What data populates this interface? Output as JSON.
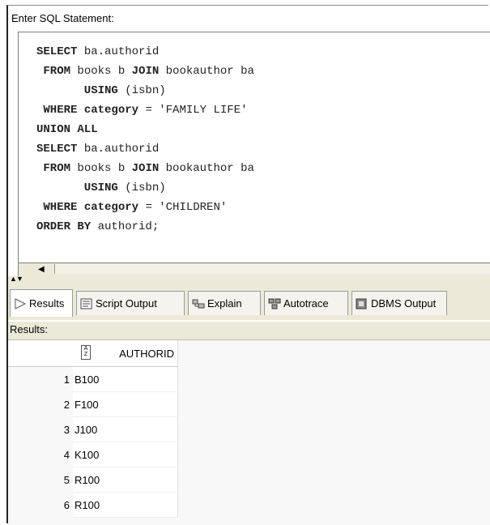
{
  "editor": {
    "label": "Enter SQL Statement:",
    "lines": [
      [
        {
          "t": "SELECT",
          "k": true
        },
        {
          "t": " ba.authorid",
          "k": false
        }
      ],
      [
        {
          "t": " FROM",
          "k": true
        },
        {
          "t": " books b ",
          "k": false
        },
        {
          "t": "JOIN",
          "k": true
        },
        {
          "t": " bookauthor ba",
          "k": false
        }
      ],
      [
        {
          "t": "       USING",
          "k": true
        },
        {
          "t": " (isbn)",
          "k": false
        }
      ],
      [
        {
          "t": " WHERE",
          "k": true
        },
        {
          "t": " ",
          "k": false
        },
        {
          "t": "category",
          "k": true
        },
        {
          "t": " = 'FAMILY LIFE'",
          "k": false
        }
      ],
      [
        {
          "t": "UNION ALL",
          "k": true
        }
      ],
      [
        {
          "t": "SELECT",
          "k": true
        },
        {
          "t": " ba.authorid",
          "k": false
        }
      ],
      [
        {
          "t": " FROM",
          "k": true
        },
        {
          "t": " books b ",
          "k": false
        },
        {
          "t": "JOIN",
          "k": true
        },
        {
          "t": " bookauthor ba",
          "k": false
        }
      ],
      [
        {
          "t": "       USING",
          "k": true
        },
        {
          "t": " (isbn)",
          "k": false
        }
      ],
      [
        {
          "t": " WHERE",
          "k": true
        },
        {
          "t": " ",
          "k": false
        },
        {
          "t": "category",
          "k": true
        },
        {
          "t": " = 'CHILDREN'",
          "k": false
        }
      ],
      [
        {
          "t": "ORDER BY",
          "k": true
        },
        {
          "t": " authorid;",
          "k": false
        }
      ]
    ]
  },
  "tabs": [
    {
      "label": "Results",
      "icon": "play-arrow-icon",
      "active": true
    },
    {
      "label": "Script Output",
      "icon": "script-output-icon",
      "active": false
    },
    {
      "label": "Explain",
      "icon": "explain-plan-icon",
      "active": false
    },
    {
      "label": "Autotrace",
      "icon": "autotrace-icon",
      "active": false
    },
    {
      "label": "DBMS Output",
      "icon": "dbms-output-icon",
      "active": false
    }
  ],
  "results": {
    "label": "Results:",
    "column": "AUTHORID",
    "rows": [
      {
        "n": "1",
        "v": "B100"
      },
      {
        "n": "2",
        "v": "F100"
      },
      {
        "n": "3",
        "v": "J100"
      },
      {
        "n": "4",
        "v": "K100"
      },
      {
        "n": "5",
        "v": "R100"
      },
      {
        "n": "6",
        "v": "R100"
      }
    ]
  }
}
